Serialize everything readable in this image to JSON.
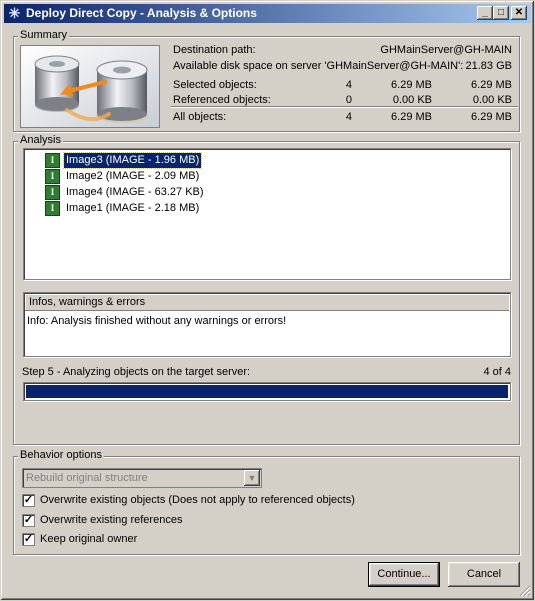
{
  "window": {
    "title": "Deploy Direct Copy - Analysis & Options",
    "minimize_label": "_",
    "maximize_label": "□",
    "close_label": "✕",
    "app_icon": "✳"
  },
  "summary": {
    "label": "Summary",
    "destination_label": "Destination path:",
    "destination_value": "GHMainServer@GH-MAIN",
    "disk_space_label": "Available disk space on server 'GHMainServer@GH-MAIN':",
    "disk_space_value": "21.83 GB",
    "rows": [
      {
        "label": "Selected objects:",
        "count": "4",
        "size": "6.29 MB",
        "total": "6.29 MB"
      },
      {
        "label": "Referenced objects:",
        "count": "0",
        "size": "0.00 KB",
        "total": "0.00 KB"
      },
      {
        "label": "All objects:",
        "count": "4",
        "size": "6.29 MB",
        "total": "6.29 MB"
      }
    ]
  },
  "analysis": {
    "label": "Analysis",
    "items": [
      {
        "label": "Image3 (IMAGE - 1.96 MB)",
        "selected": true
      },
      {
        "label": "Image2 (IMAGE - 2.09 MB)",
        "selected": false
      },
      {
        "label": "Image4 (IMAGE - 63.27 KB)",
        "selected": false
      },
      {
        "label": "Image1 (IMAGE - 2.18 MB)",
        "selected": false
      }
    ],
    "item_icon": "I",
    "messages_header": "Infos, warnings & errors",
    "messages_text": "Info: Analysis finished without any warnings or errors!",
    "step_label": "Step 5 - Analyzing objects on the target server:",
    "step_count": "4 of 4",
    "progress": 1.0
  },
  "behavior": {
    "label": "Behavior options",
    "dropdown_value": "Rebuild original structure",
    "options": [
      {
        "label": "Overwrite existing objects (Does not apply to referenced objects)",
        "checked": true
      },
      {
        "label": "Overwrite existing references",
        "checked": true
      },
      {
        "label": "Keep original owner",
        "checked": true
      }
    ]
  },
  "buttons": {
    "continue_label": "Continue...",
    "cancel_label": "Cancel"
  },
  "colors": {
    "selection": "#0a246a",
    "progress": "#0a246a",
    "title_start": "#0a246a",
    "title_end": "#a6caf0",
    "image_icon": "#2e7d32"
  }
}
